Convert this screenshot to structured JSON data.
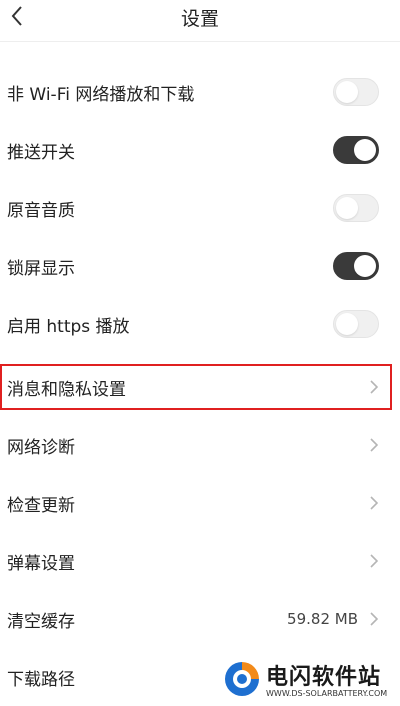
{
  "header": {
    "title": "设置",
    "back_icon": "chevron-left-icon"
  },
  "rows": [
    {
      "label": "非 Wi-Fi 网络播放和下载",
      "type": "toggle",
      "on": false
    },
    {
      "label": "推送开关",
      "type": "toggle",
      "on": true
    },
    {
      "label": "原音音质",
      "type": "toggle",
      "on": false
    },
    {
      "label": "锁屏显示",
      "type": "toggle",
      "on": true
    },
    {
      "label": "启用 https 播放",
      "type": "toggle",
      "on": false
    },
    {
      "label": "消息和隐私设置",
      "type": "link",
      "highlighted": true
    },
    {
      "label": "网络诊断",
      "type": "link"
    },
    {
      "label": "检查更新",
      "type": "link"
    },
    {
      "label": "弹幕设置",
      "type": "link"
    },
    {
      "label": "清空缓存",
      "type": "link",
      "value": "59.82 MB"
    },
    {
      "label": "下载路径",
      "type": "link"
    }
  ],
  "watermark": {
    "title": "电闪软件站",
    "subtitle": "WWW.DS-SOLARBATTERY.COM"
  },
  "colors": {
    "toggle_on": "#3a3a3a",
    "toggle_off": "#f0f0f0",
    "highlight": "#e02020",
    "chevron": "#b5b5b5"
  }
}
